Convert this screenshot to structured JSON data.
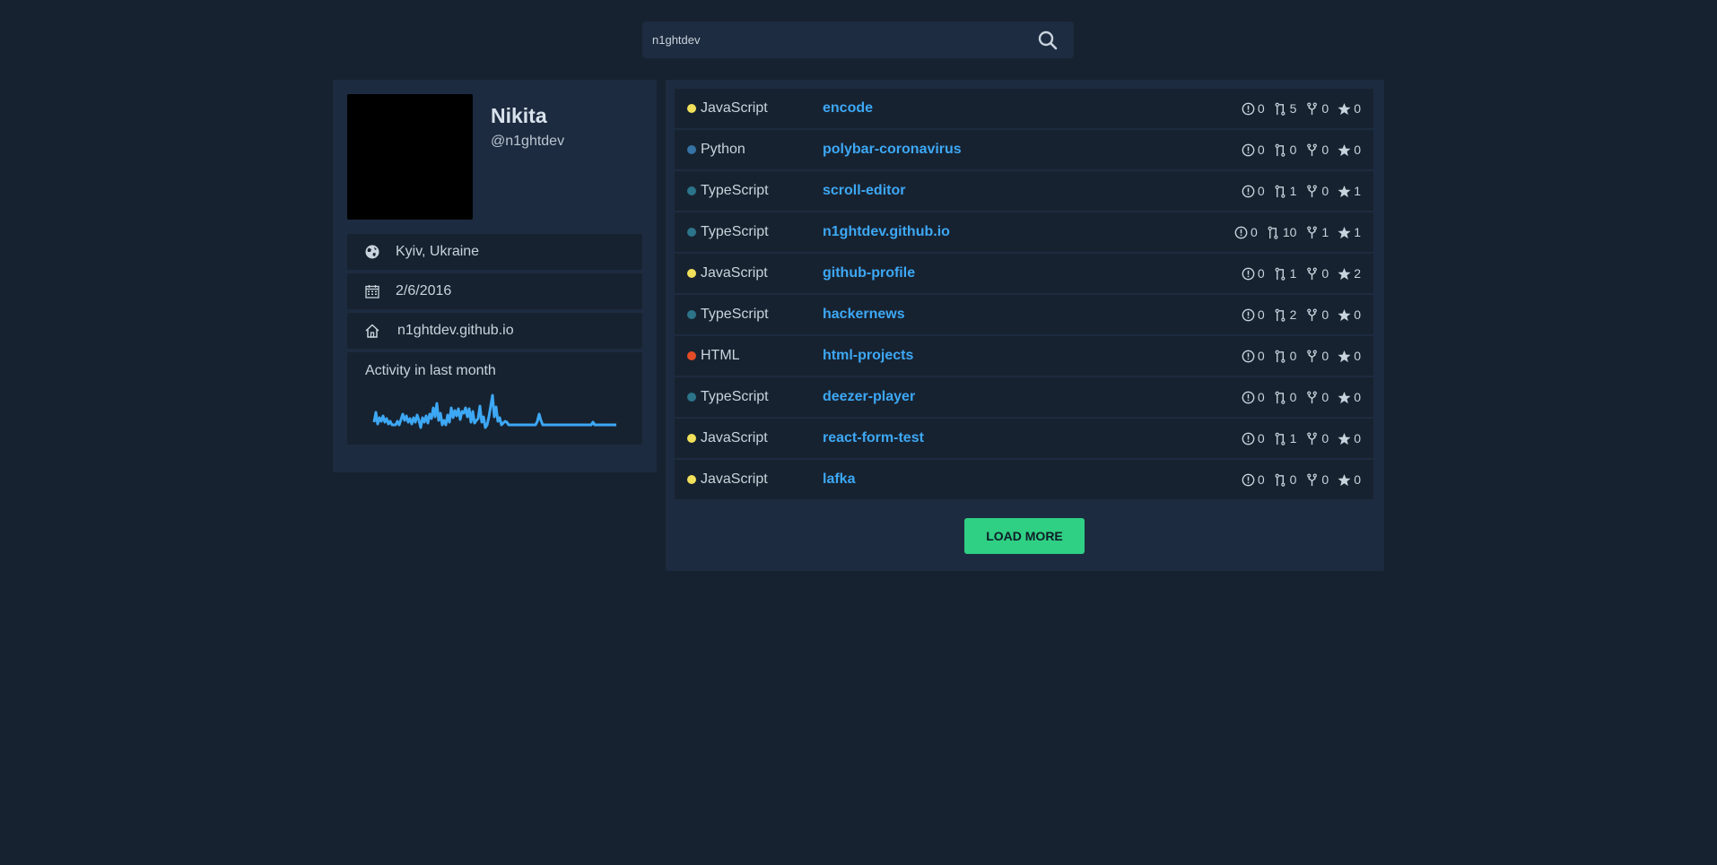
{
  "search": {
    "value": "n1ghtdev",
    "icon": "search-icon"
  },
  "profile": {
    "name": "Nikita",
    "login": "@n1ghtdev",
    "location": "Kyiv, Ukraine",
    "joined": "2/6/2016",
    "website": "n1ghtdev.github.io",
    "activity_title": "Activity in last month"
  },
  "colors": {
    "JavaScript": "#f1e05a",
    "Python": "#3572a5",
    "TypeScript": "#2b7489",
    "HTML": "#e34c26",
    "accent": "#3da8f5",
    "button": "#2fd083"
  },
  "repos": [
    {
      "language": "JavaScript",
      "name": "encode",
      "issues": "0",
      "prs": "5",
      "forks": "0",
      "stars": "0"
    },
    {
      "language": "Python",
      "name": "polybar-coronavirus",
      "issues": "0",
      "prs": "0",
      "forks": "0",
      "stars": "0"
    },
    {
      "language": "TypeScript",
      "name": "scroll-editor",
      "issues": "0",
      "prs": "1",
      "forks": "0",
      "stars": "1"
    },
    {
      "language": "TypeScript",
      "name": "n1ghtdev.github.io",
      "issues": "0",
      "prs": "10",
      "forks": "1",
      "stars": "1"
    },
    {
      "language": "JavaScript",
      "name": "github-profile",
      "issues": "0",
      "prs": "1",
      "forks": "0",
      "stars": "2"
    },
    {
      "language": "TypeScript",
      "name": "hackernews",
      "issues": "0",
      "prs": "2",
      "forks": "0",
      "stars": "0"
    },
    {
      "language": "HTML",
      "name": "html-projects",
      "issues": "0",
      "prs": "0",
      "forks": "0",
      "stars": "0"
    },
    {
      "language": "TypeScript",
      "name": "deezer-player",
      "issues": "0",
      "prs": "0",
      "forks": "0",
      "stars": "0"
    },
    {
      "language": "JavaScript",
      "name": "react-form-test",
      "issues": "0",
      "prs": "1",
      "forks": "0",
      "stars": "0"
    },
    {
      "language": "JavaScript",
      "name": "lafka",
      "issues": "0",
      "prs": "0",
      "forks": "0",
      "stars": "0"
    }
  ],
  "load_more": "LOAD MORE"
}
